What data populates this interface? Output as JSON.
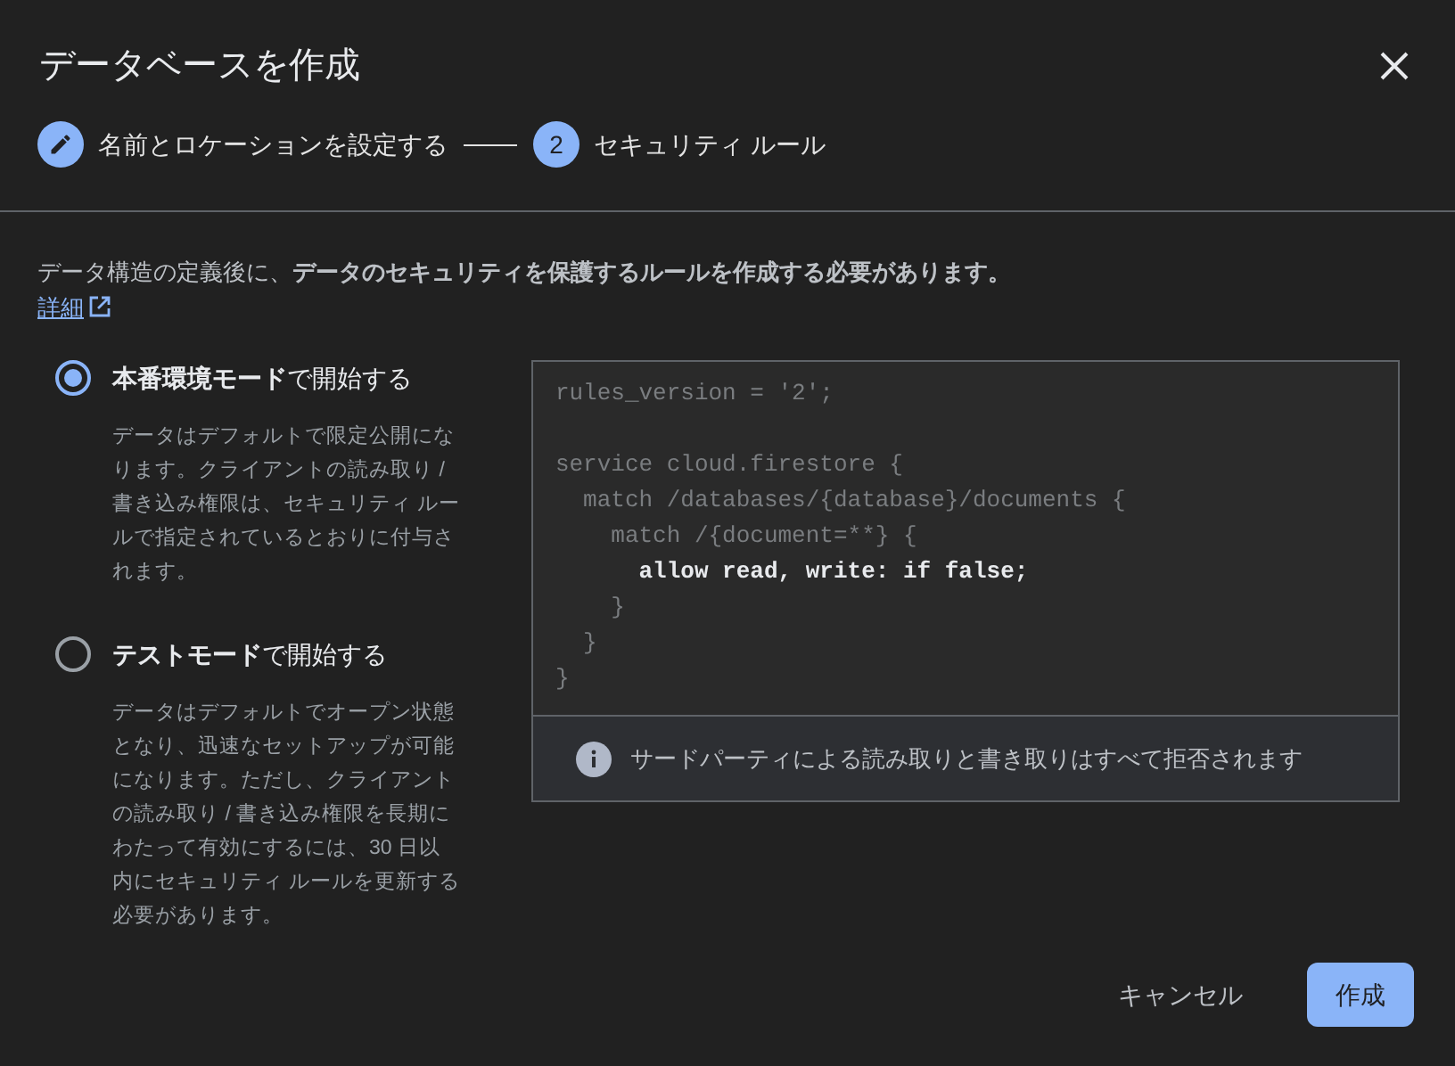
{
  "dialog": {
    "title": "データベースを作成"
  },
  "steps": [
    {
      "label": "名前とロケーションを設定する",
      "completed": true
    },
    {
      "number": "2",
      "label": "セキュリティ ルール",
      "completed": false
    }
  ],
  "intro": {
    "text": "データ構造の定義後に、**データのセキュリティを保護するルールを作成する必要があります。**",
    "link": "詳細"
  },
  "modes": [
    {
      "title": "**本番環境モード**で開始する",
      "selected": true,
      "description": "データはデフォルトで限定公開になります。クライアントの読み取り / 書き込み権限は、セキュリティ ルールで指定されているとおりに付与されます。"
    },
    {
      "title": "**テストモード**で開始する",
      "selected": false,
      "description": "データはデフォルトでオープン状態となり、迅速なセットアップが可能になります。ただし、クライアントの読み取り / 書き込み権限を長期にわたって有効にするには、30 日以内にセキュリティ ルールを更新する必要があります。"
    }
  ],
  "code": {
    "blocks": [
      [
        {
          "text": "rules_version = '2';",
          "emphasis": false
        }
      ],
      [
        {
          "text": "service cloud.firestore {",
          "emphasis": false
        },
        {
          "text": "  match /databases/{database}/documents {",
          "emphasis": false
        },
        {
          "text": "    match /{document=**} {",
          "emphasis": false
        },
        {
          "text": "      allow read, write: if false;",
          "emphasis": true
        },
        {
          "text": "    }",
          "emphasis": false
        },
        {
          "text": "  }",
          "emphasis": false
        },
        {
          "text": "}",
          "emphasis": false
        }
      ]
    ],
    "notice": "サードパーティによる読み取りと書き取りはすべて拒否されます"
  },
  "buttons": [
    {
      "label": "キャンセル",
      "kind": "text"
    },
    {
      "label": "作成",
      "kind": "primary"
    }
  ]
}
